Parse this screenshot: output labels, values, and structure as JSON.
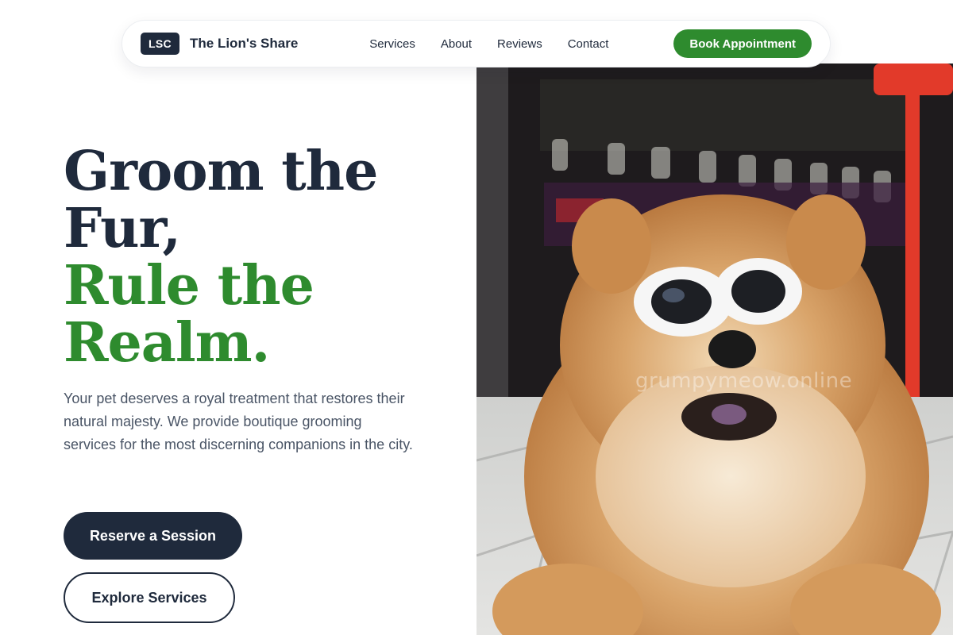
{
  "brand": {
    "logo_text": "LSC",
    "name": "The Lion's Share"
  },
  "nav": {
    "links": [
      "Services",
      "About",
      "Reviews",
      "Contact"
    ],
    "cta_label": "Book Appointment"
  },
  "hero": {
    "title_line1": "Groom the",
    "title_line2": "Fur,",
    "title_line3": "Rule the",
    "title_line4": "Realm.",
    "description": "Your pet deserves a royal treatment that restores their natural majesty. We provide boutique grooming services for the most discerning companions in the city.",
    "primary_button": "Reserve a Session",
    "secondary_button": "Explore Services",
    "image_watermark": "grumpymeow.online"
  },
  "colors": {
    "accent_green": "#2e8b2e",
    "navy": "#1f2a3c",
    "body_text": "#4a5566",
    "background": "#ffffff"
  }
}
